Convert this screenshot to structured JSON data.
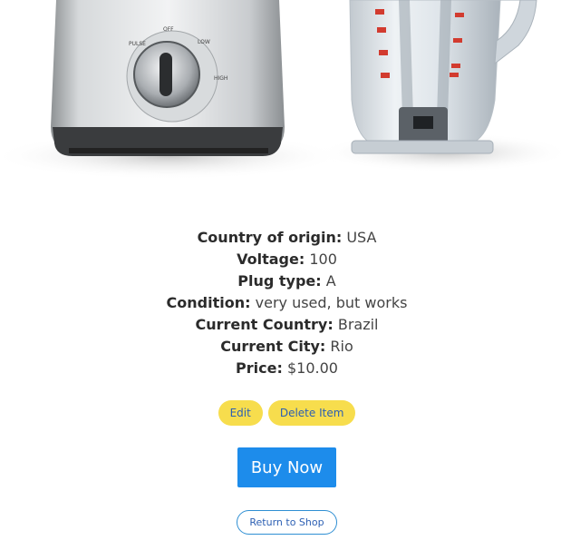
{
  "product": {
    "image_alt": "Food processor and blender jug",
    "image_text": {
      "dial": [
        "PULSE",
        "OFF",
        "LOW",
        "HIGH"
      ]
    }
  },
  "details": [
    {
      "label": "Country of origin:",
      "value": "USA"
    },
    {
      "label": "Voltage:",
      "value": "100"
    },
    {
      "label": "Plug type:",
      "value": "A"
    },
    {
      "label": "Condition:",
      "value": "very used, but works"
    },
    {
      "label": "Current Country:",
      "value": "Brazil"
    },
    {
      "label": "Current City:",
      "value": "Rio"
    },
    {
      "label": "Price:",
      "value": "$10.00"
    }
  ],
  "actions": {
    "edit_label": "Edit",
    "delete_label": "Delete Item",
    "buy_label": "Buy Now",
    "return_label": "Return to Shop"
  },
  "colors": {
    "pill_yellow": "#f7dd4d",
    "link_blue": "#2c5fb3",
    "buy_blue": "#1d8ceb"
  }
}
